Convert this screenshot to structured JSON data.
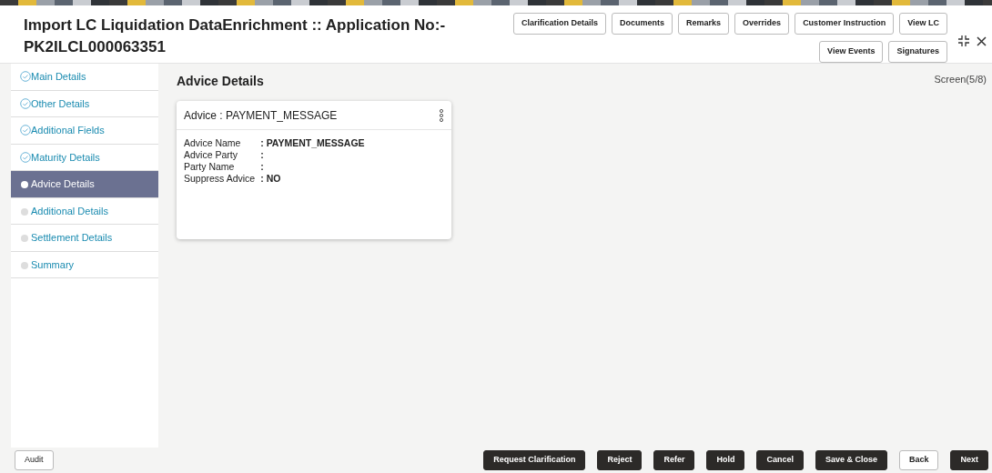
{
  "header": {
    "title": "Import LC Liquidation DataEnrichment :: Application No:-",
    "application_no": "PK2ILCL000063351"
  },
  "header_buttons": [
    [
      "Clarification Details",
      "Documents",
      "Remarks",
      "Overrides",
      "Customer Instruction",
      "View LC"
    ],
    [
      "View Events",
      "Signatures"
    ]
  ],
  "steps": [
    {
      "label": "Main Details",
      "done": true,
      "selected": false
    },
    {
      "label": "Other Details",
      "done": true,
      "selected": false
    },
    {
      "label": "Additional Fields",
      "done": true,
      "selected": false
    },
    {
      "label": "Maturity Details",
      "done": true,
      "selected": false
    },
    {
      "label": "Advice Details",
      "done": false,
      "selected": true
    },
    {
      "label": "Additional Details",
      "done": false,
      "selected": false
    },
    {
      "label": "Settlement Details",
      "done": false,
      "selected": false
    },
    {
      "label": "Summary",
      "done": false,
      "selected": false
    }
  ],
  "content": {
    "title": "Advice Details",
    "screen": "Screen(5/8)"
  },
  "card": {
    "title": "Advice : PAYMENT_MESSAGE",
    "fields": [
      {
        "label": "Advice Name",
        "value": ": PAYMENT_MESSAGE"
      },
      {
        "label": "Advice Party",
        "value": ":"
      },
      {
        "label": "Party Name",
        "value": ":"
      },
      {
        "label": "Suppress Advice",
        "value": ": NO"
      }
    ]
  },
  "footer": {
    "left": [
      "Audit"
    ],
    "right": [
      {
        "label": "Request Clarification",
        "kind": "primary"
      },
      {
        "label": "Reject",
        "kind": "primary"
      },
      {
        "label": "Refer",
        "kind": "primary"
      },
      {
        "label": "Hold",
        "kind": "primary"
      },
      {
        "label": "Cancel",
        "kind": "primary"
      },
      {
        "label": "Save & Close",
        "kind": "primary"
      },
      {
        "label": "Back",
        "kind": "outline"
      },
      {
        "label": "Next",
        "kind": "primary"
      }
    ]
  }
}
